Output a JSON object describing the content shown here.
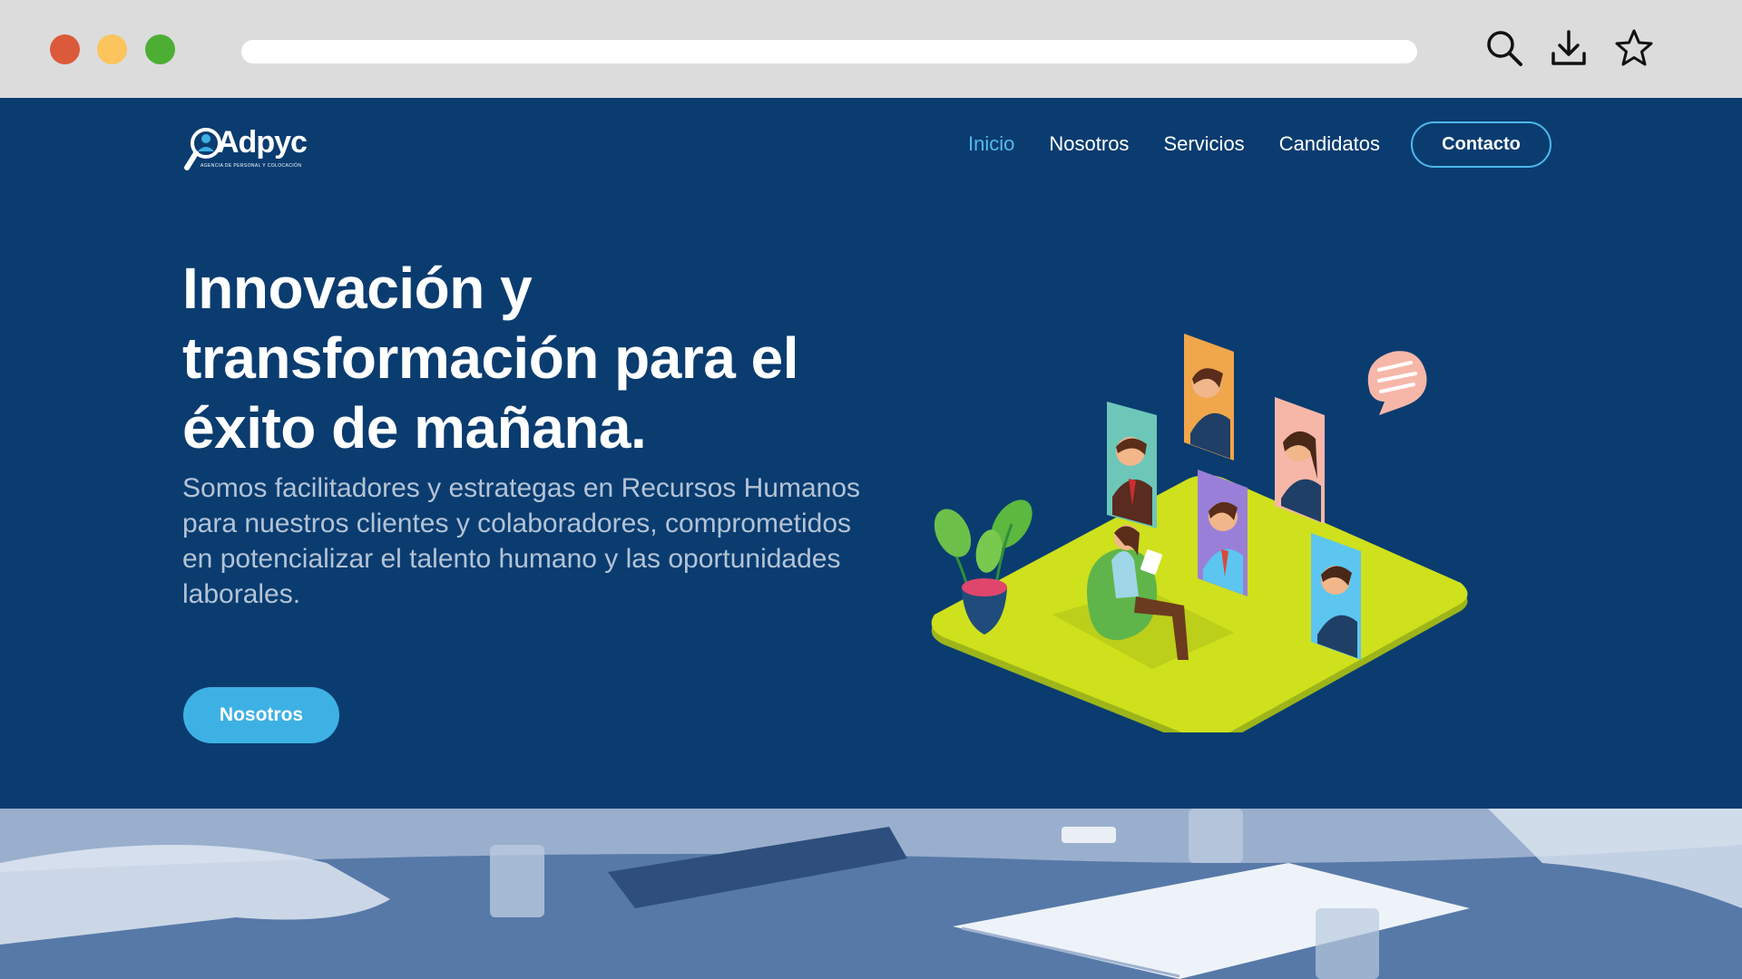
{
  "browser": {
    "icons": [
      "search-icon",
      "download-icon",
      "star-icon"
    ],
    "traffic_lights": [
      "#dc5a3c",
      "#fbc45c",
      "#4caf34"
    ]
  },
  "brand": {
    "name": "Adpyc",
    "tagline": "AGENCIA DE PERSONAL Y COLOCACIÓN"
  },
  "nav": {
    "items": [
      {
        "label": "Inicio",
        "active": true
      },
      {
        "label": "Nosotros",
        "active": false
      },
      {
        "label": "Servicios",
        "active": false
      },
      {
        "label": "Candidatos",
        "active": false
      }
    ],
    "contact_label": "Contacto"
  },
  "hero": {
    "title": "Innovación y transformación para el éxito de mañana.",
    "text": "Somos facilitadores y estrategas en Recursos Humanos para nuestros clientes y colaboradores, comprometidos en potencializar el talento humano y las oportunidades laborales.",
    "button_label": "Nosotros"
  },
  "colors": {
    "background": "#0a3c70",
    "accent": "#3db1e4",
    "active_link": "#55b9ec",
    "platform": "#cfe01c"
  }
}
